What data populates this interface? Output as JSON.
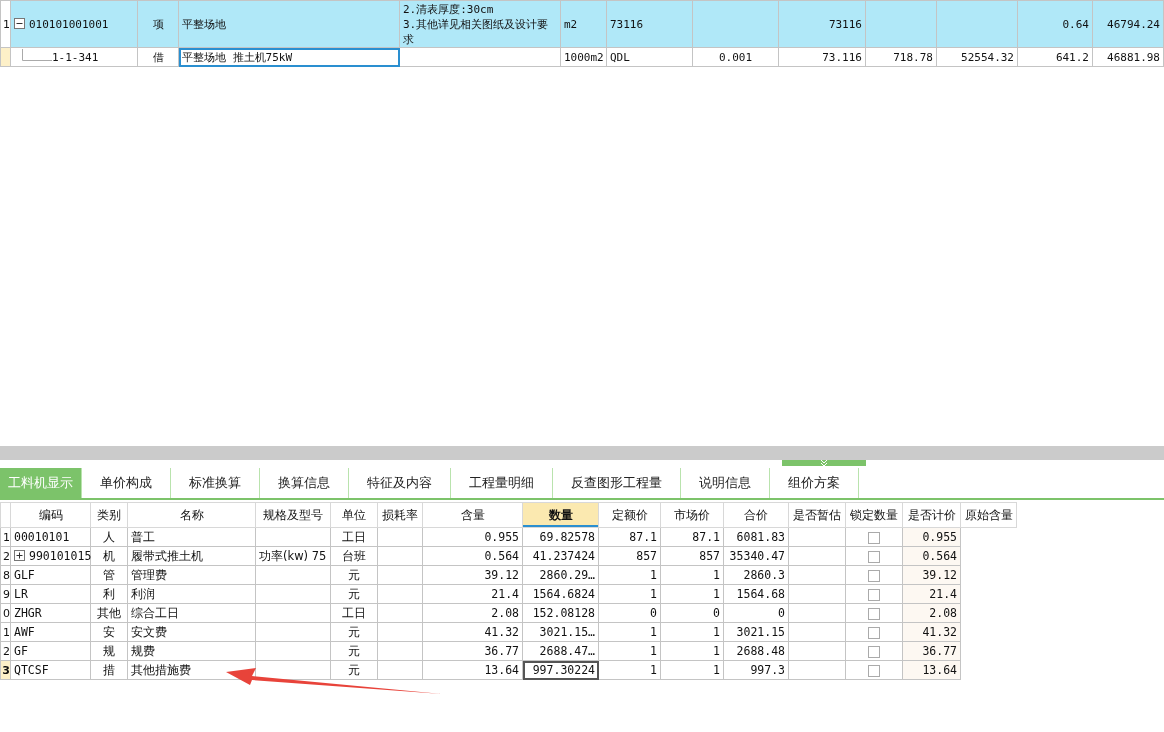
{
  "top_table": {
    "rows": [
      {
        "kind": "item",
        "stub": "1",
        "expanded": true,
        "highlighted": true,
        "selected": false,
        "cells": [
          "010101001001",
          "项",
          "平整场地",
          "2.清表厚度:30cm\n3.其他详见相关图纸及设计要求",
          "m2",
          "73116",
          "",
          "73116",
          "",
          "",
          "0.64",
          "46794.24"
        ]
      },
      {
        "kind": "sub",
        "stub": "",
        "highlighted": false,
        "selected": true,
        "cells": [
          "1-1-341",
          "借",
          "平整场地 推土机75kW",
          "",
          "1000m2",
          "QDL",
          "0.001",
          "73.116",
          "718.78",
          "52554.32",
          "641.2",
          "46881.98"
        ]
      }
    ]
  },
  "tabs": [
    {
      "label": "工料机显示",
      "selected": true
    },
    {
      "label": "单价构成",
      "selected": false
    },
    {
      "label": "标准换算",
      "selected": false
    },
    {
      "label": "换算信息",
      "selected": false
    },
    {
      "label": "特征及内容",
      "selected": false
    },
    {
      "label": "工程量明细",
      "selected": false
    },
    {
      "label": "反查图形工程量",
      "selected": false
    },
    {
      "label": "说明信息",
      "selected": false
    },
    {
      "label": "组价方案",
      "selected": false
    }
  ],
  "grid": {
    "columns": [
      {
        "label": "编码",
        "selected": false
      },
      {
        "label": "类别",
        "selected": false
      },
      {
        "label": "名称",
        "selected": false
      },
      {
        "label": "规格及型号",
        "selected": false
      },
      {
        "label": "单位",
        "selected": false
      },
      {
        "label": "损耗率",
        "selected": false
      },
      {
        "label": "含量",
        "selected": false
      },
      {
        "label": "数量",
        "selected": true
      },
      {
        "label": "定额价",
        "selected": false
      },
      {
        "label": "市场价",
        "selected": false
      },
      {
        "label": "合价",
        "selected": false
      },
      {
        "label": "是否暂估",
        "selected": false
      },
      {
        "label": "锁定数量",
        "selected": false
      },
      {
        "label": "是否计价",
        "selected": false
      },
      {
        "label": "原始含量",
        "selected": false
      }
    ],
    "rows": [
      {
        "stub": "1",
        "selected": false,
        "locked": false,
        "cells": [
          "00010101",
          "人",
          "普工",
          "",
          "工日",
          "",
          "0.955",
          "69.82578",
          "87.1",
          "87.1",
          "6081.83",
          "",
          "",
          "0.955"
        ]
      },
      {
        "stub": "2",
        "selected": false,
        "locked": false,
        "expanded": false,
        "cells": [
          "990101015",
          "机",
          "履带式推土机",
          "功率(kw) 75",
          "台班",
          "",
          "0.564",
          "41.237424",
          "857",
          "857",
          "35340.47",
          "",
          "",
          "0.564"
        ]
      },
      {
        "stub": "8",
        "selected": false,
        "locked": false,
        "cells": [
          "GLF",
          "管",
          "管理费",
          "",
          "元",
          "",
          "39.12",
          "2860.29…",
          "1",
          "1",
          "2860.3",
          "",
          "",
          "39.12"
        ]
      },
      {
        "stub": "9",
        "selected": false,
        "locked": false,
        "cells": [
          "LR",
          "利",
          "利润",
          "",
          "元",
          "",
          "21.4",
          "1564.6824",
          "1",
          "1",
          "1564.68",
          "",
          "",
          "21.4"
        ]
      },
      {
        "stub": "0",
        "selected": false,
        "locked": false,
        "cells": [
          "ZHGR",
          "其他",
          "综合工日",
          "",
          "工日",
          "",
          "2.08",
          "152.08128",
          "0",
          "0",
          "0",
          "",
          "",
          "2.08"
        ]
      },
      {
        "stub": "1",
        "selected": false,
        "locked": false,
        "cells": [
          "AWF",
          "安",
          "安文费",
          "",
          "元",
          "",
          "41.32",
          "3021.15…",
          "1",
          "1",
          "3021.15",
          "",
          "",
          "41.32"
        ]
      },
      {
        "stub": "2",
        "selected": false,
        "locked": false,
        "cells": [
          "GF",
          "规",
          "规费",
          "",
          "元",
          "",
          "36.77",
          "2688.47…",
          "1",
          "1",
          "2688.48",
          "",
          "",
          "36.77"
        ]
      },
      {
        "stub": "3",
        "selected": true,
        "locked": false,
        "cells": [
          "QTCSF",
          "措",
          "其他措施费",
          "",
          "元",
          "",
          "13.64",
          "997.30224",
          "1",
          "1",
          "997.3",
          "",
          "",
          "13.64"
        ]
      }
    ]
  }
}
